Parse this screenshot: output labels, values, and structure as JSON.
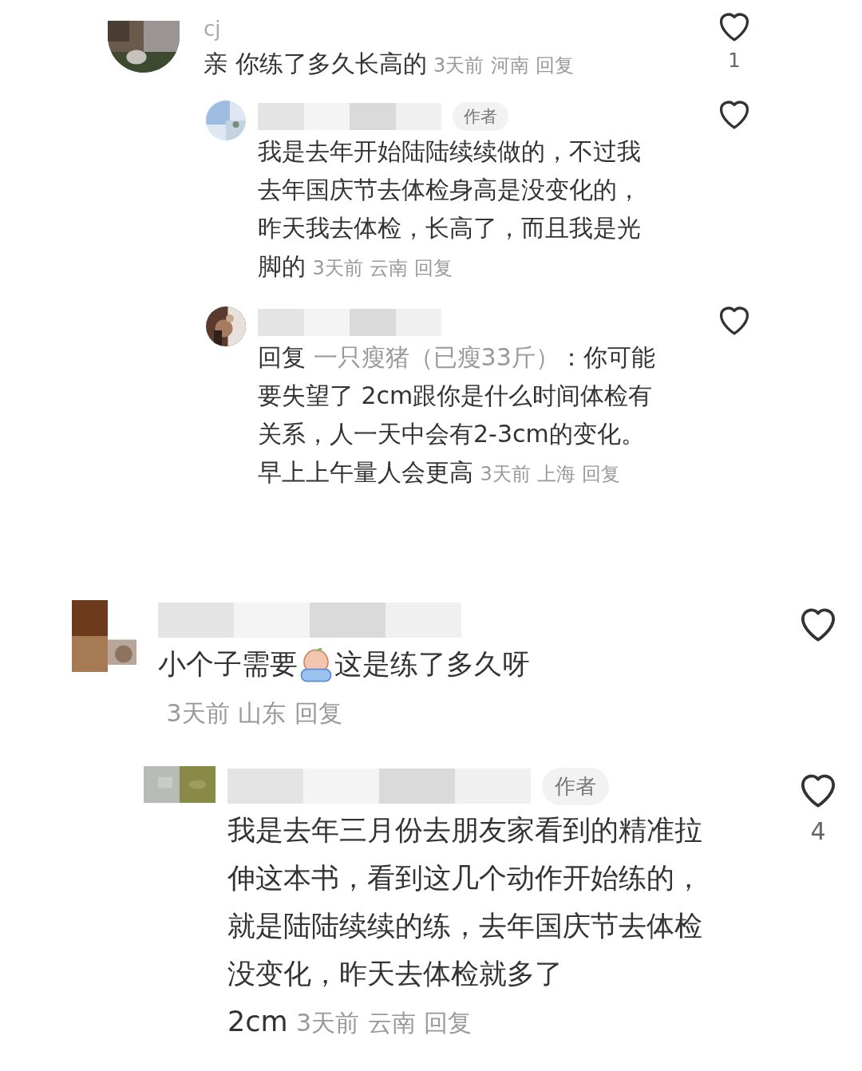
{
  "panels": [
    {
      "comments": [
        {
          "username": "cj",
          "avatar": {
            "kind": "picture"
          },
          "body": [
            {
              "kind": "text",
              "text": "亲 你练了多久长高的"
            }
          ],
          "time": "3天前",
          "location": "河南",
          "reply": "回复",
          "liked": false,
          "likes": "1",
          "replies": [
            {
              "badge": "作者",
              "avatar": {
                "kind": "picture"
              },
              "body": [
                {
                  "kind": "text",
                  "text": "我是去年开始陆陆续续做的，不过我去年国庆节去体检身高是没变化的，昨天我去体检，长高了，而且我是光脚的"
                }
              ],
              "time": "3天前",
              "location": "云南",
              "reply": "回复",
              "liked": false
            },
            {
              "avatar": {
                "kind": "picture"
              },
              "body": [
                {
                  "kind": "text",
                  "text": "回复 "
                },
                {
                  "kind": "mention",
                  "text": "一只瘦猪（已瘦33斤）"
                },
                {
                  "kind": "text",
                  "text": "：你可能要失望了  2cm跟你是什么时间体检有关系，人一天中会有2-3cm的变化。早上上午量人会更高"
                }
              ],
              "time": "3天前",
              "location": "上海",
              "reply": "回复",
              "liked": false
            }
          ]
        }
      ]
    },
    {
      "comments": [
        {
          "avatar": {
            "kind": "picture"
          },
          "body": [
            {
              "kind": "text",
              "text": "小个子需要"
            },
            {
              "kind": "emoji"
            },
            {
              "kind": "text",
              "text": "这是练了多久呀"
            }
          ],
          "time": "3天前",
          "location": "山东",
          "reply": "回复",
          "liked": false,
          "replies": [
            {
              "badge": "作者",
              "avatar": {
                "kind": "picture"
              },
              "body": [
                {
                  "kind": "text",
                  "text": "我是去年三月份去朋友家看到的精准拉伸这本书，看到这几个动作开始练的，就是陆陆续续的练，去年国庆节去体检没变化，昨天去体检就多了2cm"
                }
              ],
              "time": "3天前",
              "location": "云南",
              "reply": "回复",
              "liked": false,
              "likes": "4"
            }
          ]
        }
      ]
    }
  ]
}
